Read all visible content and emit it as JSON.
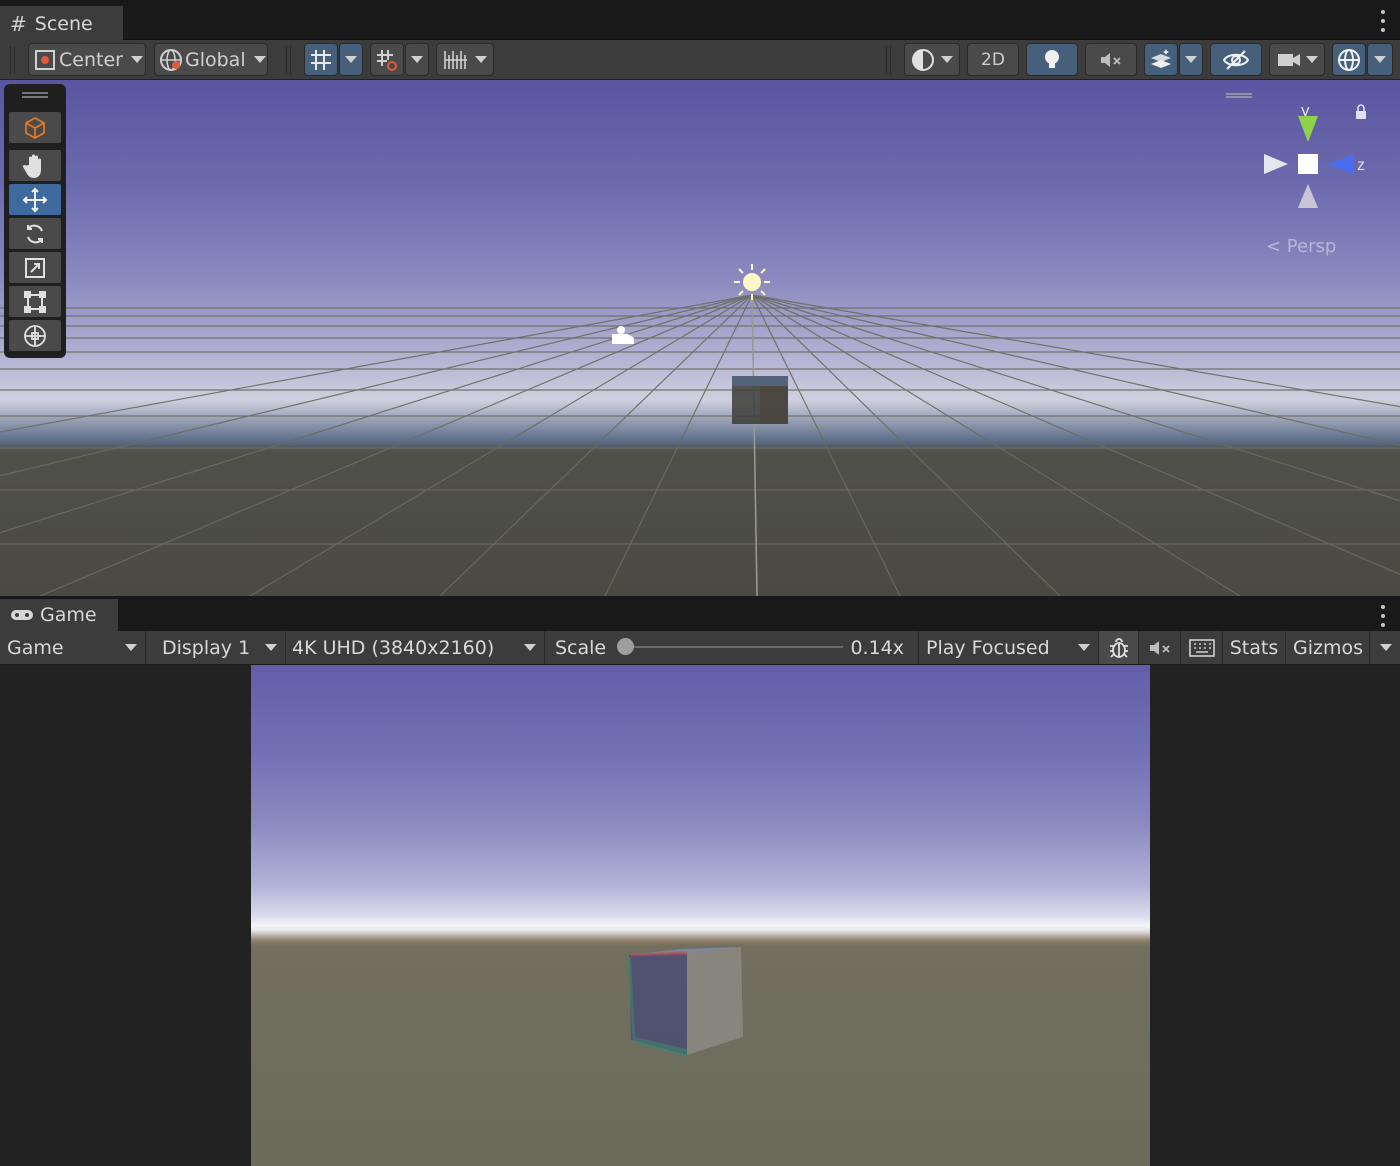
{
  "scene": {
    "tab_label": "Scene",
    "toolbar": {
      "pivot_mode": "Center",
      "pivot_rotation": "Global",
      "mode_2d": "2D"
    },
    "gizmo": {
      "y_label": "y",
      "z_label": "z",
      "projection": "< Persp"
    }
  },
  "game": {
    "tab_label": "Game",
    "toolbar": {
      "view_mode": "Game",
      "display": "Display 1",
      "resolution": "4K UHD (3840x2160)",
      "scale_label": "Scale",
      "scale_value": "0.14x",
      "play_mode": "Play Focused",
      "stats": "Stats",
      "gizmos": "Gizmos"
    },
    "scale_fraction": 0.0
  }
}
